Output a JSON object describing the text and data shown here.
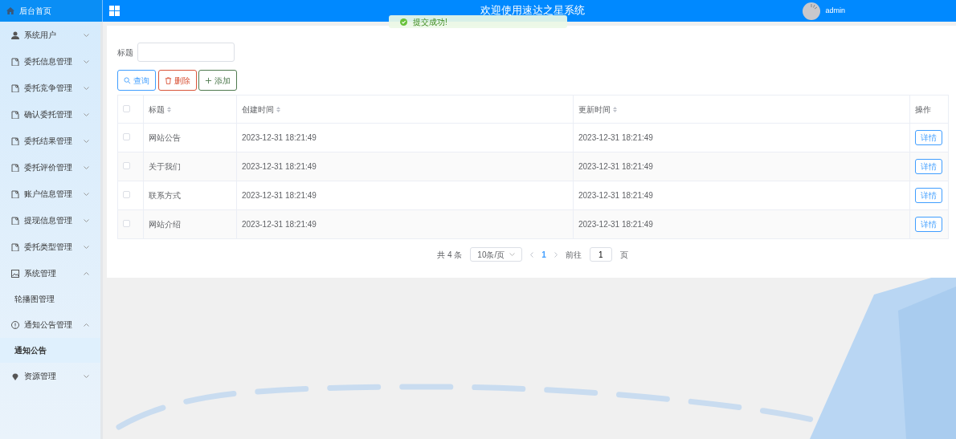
{
  "header": {
    "brand": "后台首页",
    "title": "欢迎使用速达之星系统",
    "user": "admin"
  },
  "toast": {
    "message": "提交成功!"
  },
  "sidebar": {
    "items": [
      {
        "label": "系统用户",
        "expanded": false
      },
      {
        "label": "委托信息管理",
        "expanded": false
      },
      {
        "label": "委托竞争管理",
        "expanded": false
      },
      {
        "label": "确认委托管理",
        "expanded": false
      },
      {
        "label": "委托结果管理",
        "expanded": false
      },
      {
        "label": "委托评价管理",
        "expanded": false
      },
      {
        "label": "账户信息管理",
        "expanded": false
      },
      {
        "label": "提现信息管理",
        "expanded": false
      },
      {
        "label": "委托类型管理",
        "expanded": false
      },
      {
        "label": "系统管理",
        "expanded": true,
        "children": [
          {
            "label": "轮播图管理",
            "selected": false
          }
        ]
      },
      {
        "label": "通知公告管理",
        "expanded": true,
        "children": [
          {
            "label": "通知公告",
            "selected": true
          }
        ]
      },
      {
        "label": "资源管理",
        "expanded": false
      }
    ]
  },
  "search": {
    "label": "标题"
  },
  "buttons": [
    {
      "label": "查询",
      "kind": "search"
    },
    {
      "label": "删除",
      "kind": "delete"
    },
    {
      "label": "添加",
      "kind": "add"
    }
  ],
  "table": {
    "header_checked": false,
    "columns": [
      {
        "label": "标题",
        "sortable": true
      },
      {
        "label": "创建时间",
        "sortable": true
      },
      {
        "label": "更新时间",
        "sortable": true
      },
      {
        "label": "操作",
        "sortable": false
      }
    ],
    "rows": [
      {
        "checked": false,
        "cells": [
          "网站公告",
          "2023-12-31 18:21:49",
          "2023-12-31 18:21:49"
        ],
        "action": "详情"
      },
      {
        "checked": false,
        "cells": [
          "关于我们",
          "2023-12-31 18:21:49",
          "2023-12-31 18:21:49"
        ],
        "action": "详情"
      },
      {
        "checked": false,
        "cells": [
          "联系方式",
          "2023-12-31 18:21:49",
          "2023-12-31 18:21:49"
        ],
        "action": "详情"
      },
      {
        "checked": false,
        "cells": [
          "网站介绍",
          "2023-12-31 18:21:49",
          "2023-12-31 18:21:49"
        ],
        "action": "详情"
      }
    ]
  },
  "pagination": {
    "total": "共 4 条",
    "page_size": "10条/页",
    "pages": [
      {
        "label": "1",
        "selected": true
      }
    ],
    "goto_label": "前往",
    "goto_value": "1",
    "page_suffix": "页"
  }
}
